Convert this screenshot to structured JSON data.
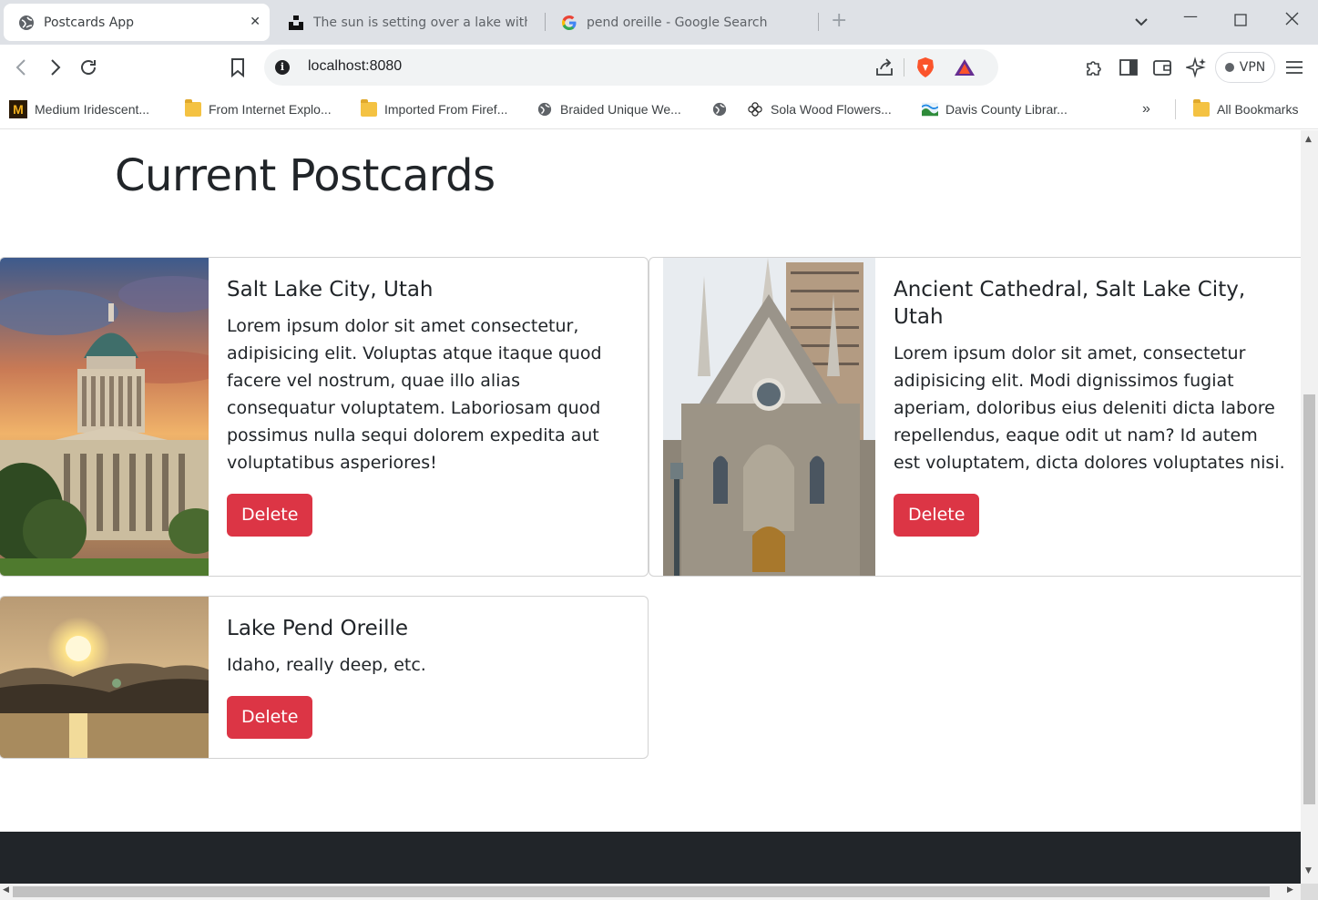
{
  "browser": {
    "tabs": [
      {
        "title": "Postcards App",
        "active": true
      },
      {
        "title": "The sun is setting over a lake with a",
        "active": false
      },
      {
        "title": "pend oreille - Google Search",
        "active": false
      }
    ],
    "url": "localhost:8080",
    "vpn_label": "VPN",
    "bookmarks": [
      {
        "label": "Medium Iridescent...",
        "icon": "m-logo-icon"
      },
      {
        "label": "From Internet Explo...",
        "icon": "folder-icon"
      },
      {
        "label": "Imported From Firef...",
        "icon": "folder-icon"
      },
      {
        "label": "Braided Unique We...",
        "icon": "globe-icon"
      },
      {
        "label": "",
        "icon": "globe-icon"
      },
      {
        "label": "Sola Wood Flowers...",
        "icon": "flower-icon"
      },
      {
        "label": "Davis County Librar...",
        "icon": "library-icon"
      }
    ],
    "all_bookmarks_label": "All Bookmarks"
  },
  "page": {
    "title": "Current Postcards",
    "postcards": [
      {
        "title": "Salt Lake City, Utah",
        "text": "Lorem ipsum dolor sit amet consectetur, adipisicing elit. Voluptas atque itaque quod facere vel nostrum, quae illo alias consequatur voluptatem. Laboriosam quod possimus nulla sequi dolorem expedita aut voluptatibus asperiores!",
        "delete_label": "Delete",
        "image": "capitol-building-photo"
      },
      {
        "title": "Ancient Cathedral, Salt Lake City, Utah",
        "text": "Lorem ipsum dolor sit amet, consectetur adipisicing elit. Modi dignissimos fugiat aperiam, doloribus eius deleniti dicta labore repellendus, eaque odit ut nam? Id autem est voluptatem, dicta dolores voluptates nisi.",
        "delete_label": "Delete",
        "image": "cathedral-photo"
      },
      {
        "title": "Lake Pend Oreille",
        "text": "Idaho, really deep, etc.",
        "delete_label": "Delete",
        "image": "lake-sunset-photo"
      }
    ]
  },
  "colors": {
    "delete": "#dc3545",
    "footer": "#212529"
  }
}
